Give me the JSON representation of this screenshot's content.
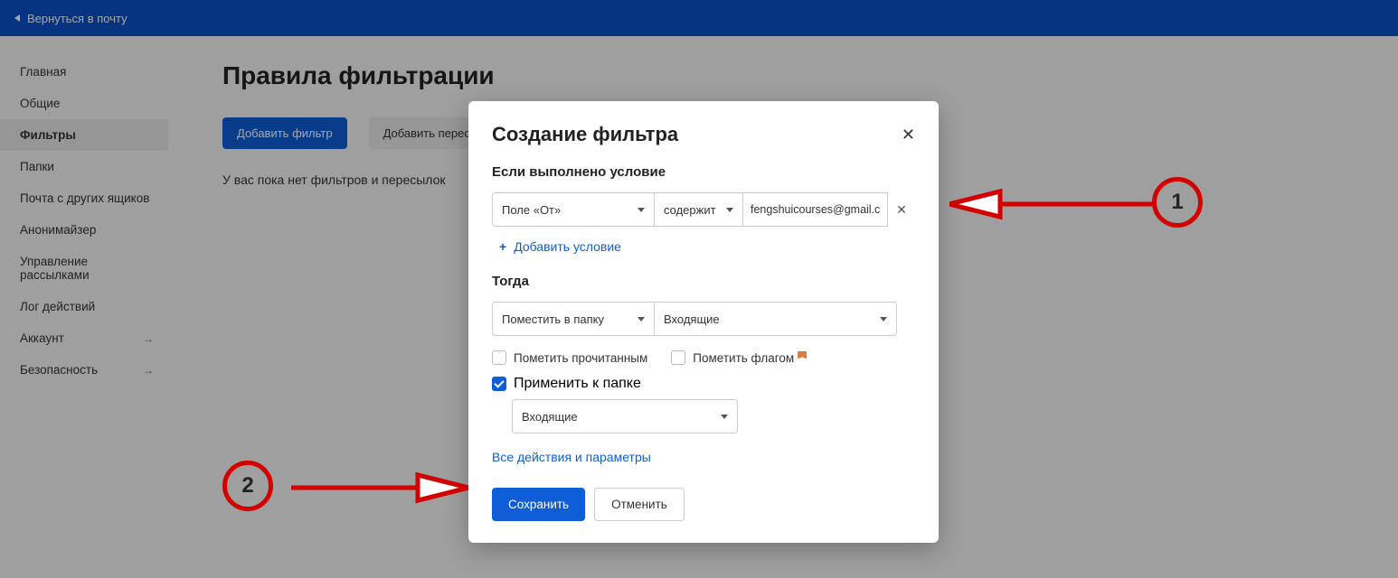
{
  "topbar": {
    "back_label": "Вернуться в почту"
  },
  "sidebar": {
    "items": [
      {
        "label": "Главная"
      },
      {
        "label": "Общие"
      },
      {
        "label": "Фильтры"
      },
      {
        "label": "Папки"
      },
      {
        "label": "Почта с других ящиков"
      },
      {
        "label": "Анонимайзер"
      },
      {
        "label": "Управление рассылками"
      },
      {
        "label": "Лог действий"
      },
      {
        "label": "Аккаунт"
      },
      {
        "label": "Безопасность"
      }
    ]
  },
  "main": {
    "title": "Правила фильтрации",
    "add_filter": "Добавить фильтр",
    "add_forward": "Добавить пересылку",
    "empty": "У вас пока нет фильтров и пересылок"
  },
  "modal": {
    "title": "Создание фильтра",
    "cond_label": "Если выполнено условие",
    "field": "Поле «От»",
    "operator": "содержит",
    "value": "fengshuicourses@gmail.com",
    "add_condition": "Добавить условие",
    "then_label": "Тогда",
    "action": "Поместить в папку",
    "action_folder": "Входящие",
    "mark_read": "Пометить прочитанным",
    "mark_flag": "Пометить флагом",
    "apply_to_folder": "Применить к папке",
    "apply_folder_value": "Входящие",
    "all_actions": "Все действия и параметры",
    "save": "Сохранить",
    "cancel": "Отменить"
  },
  "annotations": {
    "n1": "1",
    "n2": "2"
  }
}
